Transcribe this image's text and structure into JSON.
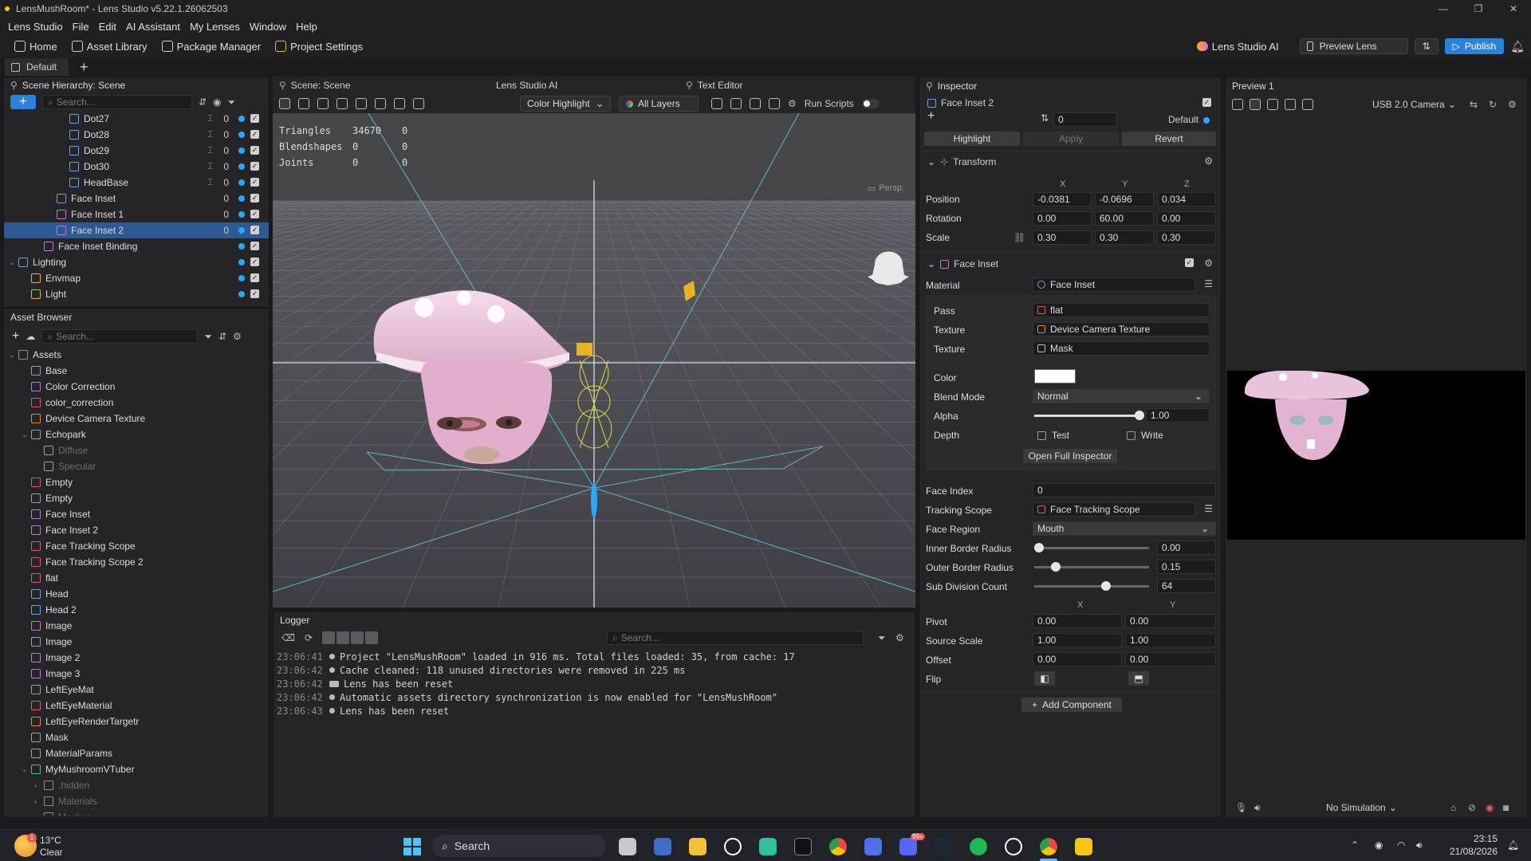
{
  "window": {
    "title": "LensMushRoom* - Lens Studio v5.22.1.26062503",
    "controls": [
      "—",
      "❐",
      "✕"
    ]
  },
  "menu": [
    "Lens Studio",
    "File",
    "Edit",
    "AI Assistant",
    "My Lenses",
    "Window",
    "Help"
  ],
  "toolbar": {
    "home": "Home",
    "asset_library": "Asset Library",
    "package_manager": "Package Manager",
    "project_settings": "Project Settings",
    "lens_studio_ai": "Lens Studio AI",
    "preview_lens": "Preview Lens",
    "publish": "Publish"
  },
  "layout_tab": "Default",
  "hierarchy": {
    "title": "Scene Hierarchy: Scene",
    "search_placeholder": "Search...",
    "rows": [
      {
        "label": "Dot27",
        "count": "0",
        "indent": 4,
        "icon": "blue",
        "layer": "⌶"
      },
      {
        "label": "Dot28",
        "count": "0",
        "indent": 4,
        "icon": "blue",
        "layer": "⌶"
      },
      {
        "label": "Dot29",
        "count": "0",
        "indent": 4,
        "icon": "blue",
        "layer": "⌶"
      },
      {
        "label": "Dot30",
        "count": "0",
        "indent": 4,
        "icon": "blue",
        "layer": "⌶"
      },
      {
        "label": "HeadBase",
        "count": "0",
        "indent": 4,
        "icon": "blue",
        "layer": "⌶"
      },
      {
        "label": "Face Inset",
        "count": "0",
        "indent": 3,
        "icon": "purple"
      },
      {
        "label": "Face Inset 1",
        "count": "0",
        "indent": 3,
        "icon": "purple"
      },
      {
        "label": "Face Inset 2",
        "count": "0",
        "indent": 3,
        "icon": "purple",
        "selected": true
      },
      {
        "label": "Face Inset Binding",
        "count": "",
        "indent": 2,
        "icon": "purple"
      },
      {
        "label": "Lighting",
        "count": "",
        "indent": 0,
        "icon": "blue",
        "arrow": "⌄"
      },
      {
        "label": "Envmap",
        "count": "",
        "indent": 1,
        "icon": "gold"
      },
      {
        "label": "Light",
        "count": "",
        "indent": 1,
        "icon": "gold"
      }
    ]
  },
  "assets": {
    "title": "Asset Browser",
    "search_placeholder": "Search...",
    "rows": [
      {
        "label": "Assets",
        "indent": 0,
        "icon": "folder",
        "arrow": "⌄"
      },
      {
        "label": "Base",
        "indent": 1,
        "icon": "gray"
      },
      {
        "label": "Color Correction",
        "indent": 1,
        "icon": "purple"
      },
      {
        "label": "color_correction",
        "indent": 1,
        "icon": "red"
      },
      {
        "label": "Device Camera Texture",
        "indent": 1,
        "icon": "orange"
      },
      {
        "label": "Echopark",
        "indent": 1,
        "icon": "gray",
        "arrow": "⌄"
      },
      {
        "label": "Diffuse",
        "indent": 2,
        "icon": "gray",
        "dim": true
      },
      {
        "label": "Specular",
        "indent": 2,
        "icon": "gray",
        "dim": true
      },
      {
        "label": "Empty",
        "indent": 1,
        "icon": "red"
      },
      {
        "label": "Empty",
        "indent": 1,
        "icon": "gray"
      },
      {
        "label": "Face Inset",
        "indent": 1,
        "icon": "purple"
      },
      {
        "label": "Face Inset 2",
        "indent": 1,
        "icon": "purple"
      },
      {
        "label": "Face Tracking Scope",
        "indent": 1,
        "icon": "red"
      },
      {
        "label": "Face Tracking Scope 2",
        "indent": 1,
        "icon": "red"
      },
      {
        "label": "flat",
        "indent": 1,
        "icon": "red"
      },
      {
        "label": "Head",
        "indent": 1,
        "icon": "blue"
      },
      {
        "label": "Head 2",
        "indent": 1,
        "icon": "blue"
      },
      {
        "label": "Image",
        "indent": 1,
        "icon": "purple"
      },
      {
        "label": "Image",
        "indent": 1,
        "icon": "gray"
      },
      {
        "label": "Image 2",
        "indent": 1,
        "icon": "purple"
      },
      {
        "label": "Image 3",
        "indent": 1,
        "icon": "purple"
      },
      {
        "label": "LeftEyeMat",
        "indent": 1,
        "icon": "gray"
      },
      {
        "label": "LeftEyeMaterial",
        "indent": 1,
        "icon": "red"
      },
      {
        "label": "LeftEyeRenderTargetr",
        "indent": 1,
        "icon": "orange"
      },
      {
        "label": "Mask",
        "indent": 1,
        "icon": "gray"
      },
      {
        "label": "MaterialParams",
        "indent": 1,
        "icon": "gray"
      },
      {
        "label": "MyMushroomVTuber",
        "indent": 1,
        "icon": "green",
        "arrow": "⌄"
      },
      {
        "label": ".hidden",
        "indent": 2,
        "icon": "folder",
        "dim": true,
        "arrow": "›"
      },
      {
        "label": "Materials",
        "indent": 2,
        "icon": "folder",
        "dim": true,
        "arrow": "›"
      },
      {
        "label": "Meshes",
        "indent": 2,
        "icon": "folder",
        "dim": true,
        "arrow": "›"
      }
    ]
  },
  "scene": {
    "tabs": [
      "Scene: Scene",
      "Lens Studio AI",
      "Text Editor"
    ],
    "color_mode": "Color Highlight",
    "layers": "All Layers",
    "run_scripts": "Run Scripts",
    "stats": [
      {
        "label": "Triangles",
        "a": "34670",
        "b": "0"
      },
      {
        "label": "Blendshapes",
        "a": "0",
        "b": "0"
      },
      {
        "label": "Joints",
        "a": "0",
        "b": "0"
      }
    ],
    "persp": "Persp."
  },
  "logger": {
    "title": "Logger",
    "search_placeholder": "Search...",
    "lines": [
      {
        "time": "23:06:41",
        "text": "Project \"LensMushRoom\" loaded in 916 ms. Total files loaded: 35, from cache: 17"
      },
      {
        "time": "23:06:42",
        "text": "Cache cleaned: 118 unused directories were removed in 225 ms"
      },
      {
        "time": "23:06:42",
        "text": "Lens has been reset"
      },
      {
        "time": "23:06:42",
        "text": "Automatic assets directory synchronization is now enabled for \"LensMushRoom\""
      },
      {
        "time": "23:06:43",
        "text": "Lens has been reset"
      }
    ]
  },
  "inspector": {
    "title": "Inspector",
    "object_name": "Face Inset 2",
    "layer_value": "0",
    "layer_name": "Default",
    "highlight": "Highlight",
    "apply": "Apply",
    "revert": "Revert",
    "transform": {
      "title": "Transform",
      "axes": [
        "X",
        "Y",
        "Z"
      ],
      "position_label": "Position",
      "position": [
        "-0.0381",
        "-0.0696",
        "0.034"
      ],
      "rotation_label": "Rotation",
      "rotation": [
        "0.00",
        "60.00",
        "0.00"
      ],
      "scale_label": "Scale",
      "scale": [
        "0.30",
        "0.30",
        "0.30"
      ]
    },
    "face_inset": {
      "title": "Face Inset",
      "material_label": "Material",
      "material": "Face Inset",
      "pass_label": "Pass",
      "pass": "flat",
      "texture_label": "Texture",
      "texture1": "Device Camera Texture",
      "texture2": "Mask",
      "color_label": "Color",
      "blend_label": "Blend Mode",
      "blend": "Normal",
      "alpha_label": "Alpha",
      "alpha": "1.00",
      "depth_label": "Depth",
      "depth_test": "Test",
      "depth_write": "Write",
      "open_full": "Open Full Inspector",
      "face_index_label": "Face Index",
      "face_index": "0",
      "tracking_label": "Tracking Scope",
      "tracking": "Face Tracking Scope",
      "region_label": "Face Region",
      "region": "Mouth",
      "inner_label": "Inner Border Radius",
      "inner": "0.00",
      "outer_label": "Outer Border Radius",
      "outer": "0.15",
      "subdiv_label": "Sub Division Count",
      "subdiv": "64",
      "xy": [
        "X",
        "Y"
      ],
      "pivot_label": "Pivot",
      "pivot": [
        "0.00",
        "0.00"
      ],
      "srcscale_label": "Source Scale",
      "srcscale": [
        "1.00",
        "1.00"
      ],
      "offset_label": "Offset",
      "offset": [
        "0.00",
        "0.00"
      ],
      "flip_label": "Flip"
    },
    "add_component": "Add Component"
  },
  "preview": {
    "title": "Preview 1",
    "camera": "USB 2.0 Camera",
    "simulation": "No Simulation"
  },
  "taskbar": {
    "weather_temp": "13°C",
    "weather_desc": "Clear",
    "search": "Search",
    "time": "23:15",
    "date": "21/08/2026",
    "badge": "99+"
  },
  "colors": {
    "accent": "#2a82da",
    "selection": "#2d5a93",
    "toggle_dot": "#2aa6ff"
  }
}
